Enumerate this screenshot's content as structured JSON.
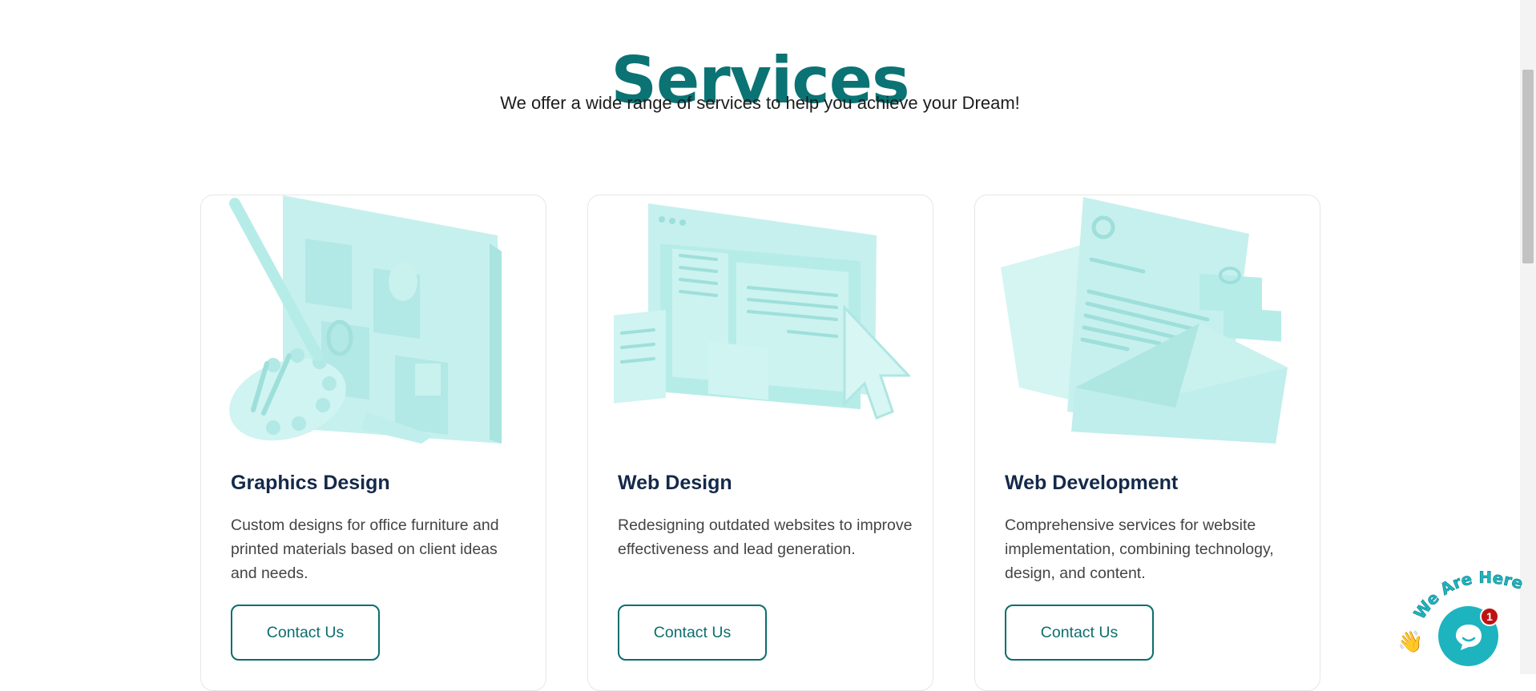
{
  "section": {
    "title": "Services",
    "subtitle": "We offer a wide range of services to help you achieve your Dream!"
  },
  "services": [
    {
      "title": "Graphics Design",
      "description": "Custom designs for office furniture and printed materials based on client ideas and needs.",
      "button": "Contact Us",
      "illustration": "paint-palette-monitor-icon"
    },
    {
      "title": "Web Design",
      "description": "Redesigning outdated websites to improve effectiveness and lead generation.",
      "button": "Contact Us",
      "illustration": "browser-layout-cursor-icon"
    },
    {
      "title": "Web Development",
      "description": "Comprehensive services for website implementation, combining technology, design, and content.",
      "button": "Contact Us",
      "illustration": "documents-envelope-icon"
    }
  ],
  "chat_widget": {
    "banner": "We Are Here!",
    "badge_count": "1",
    "icon": "chat-bubble-icon"
  },
  "colors": {
    "accent": "#0b7373",
    "heading": "#14294a",
    "illustration": "#bfeeec",
    "chat": "#1db4c0",
    "badge": "#c01212"
  }
}
